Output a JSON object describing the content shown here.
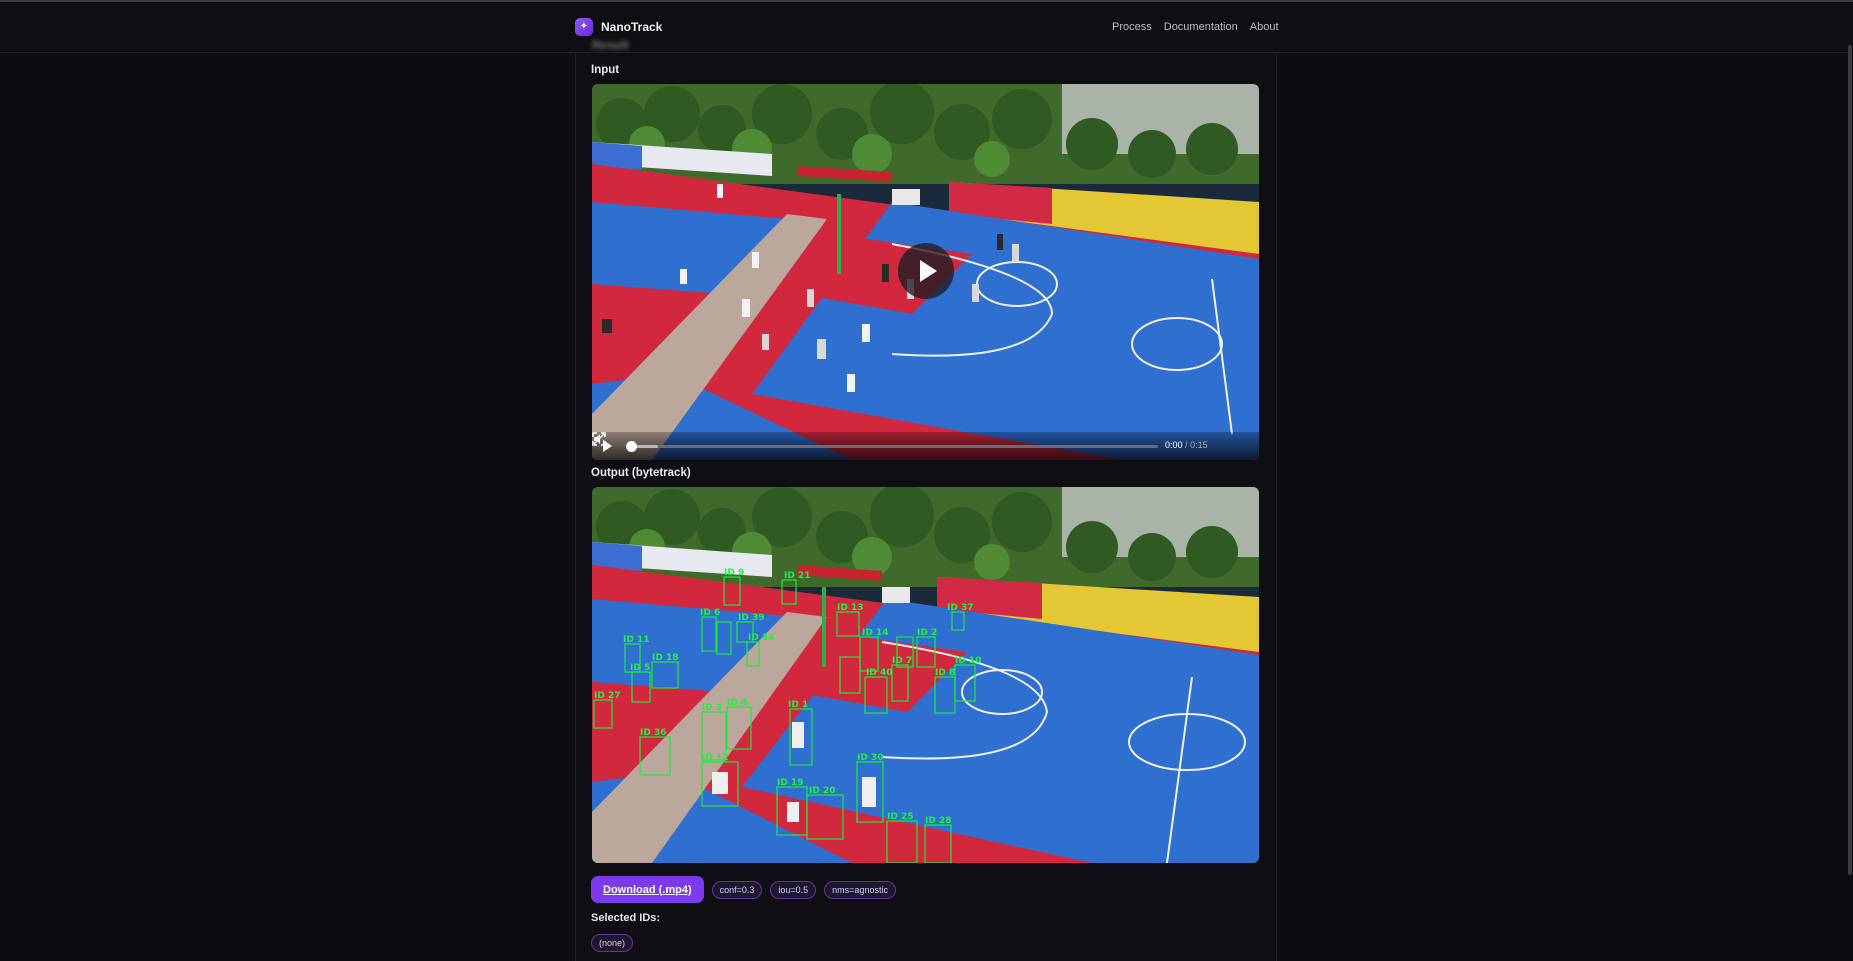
{
  "app": {
    "name": "NanoTrack",
    "nav": [
      "Process",
      "Documentation",
      "About"
    ],
    "page_title_blurred": "Result"
  },
  "input": {
    "label": "Input",
    "video": {
      "current_time": "0:00",
      "duration": "0:15",
      "progress": 0.0
    }
  },
  "output": {
    "label": "Output (bytetrack)",
    "track_ids": [
      "ID 27",
      "ID 11",
      "ID 18",
      "ID 13",
      "ID 21",
      "ID 39",
      "ID 34",
      "ID 37",
      "ID 2",
      "ID 10",
      "ID 40",
      "ID 1",
      "ID 30",
      "ID 19",
      "ID 20",
      "ID 25",
      "ID 28",
      "ID 9",
      "ID 5",
      "ID 14",
      "ID 6",
      "ID 7",
      "ID 8"
    ]
  },
  "actions": {
    "download_label": "Download (.mp4)",
    "params": [
      "conf=0.3",
      "iou=0.5",
      "nms=agnostic"
    ]
  },
  "selection": {
    "label": "Selected IDs:",
    "value": "(none)"
  },
  "colors": {
    "accent": "#7c3aed",
    "bbox": "#1eea3a",
    "court_blue": "#2f6fd0",
    "court_red": "#d2283e"
  }
}
